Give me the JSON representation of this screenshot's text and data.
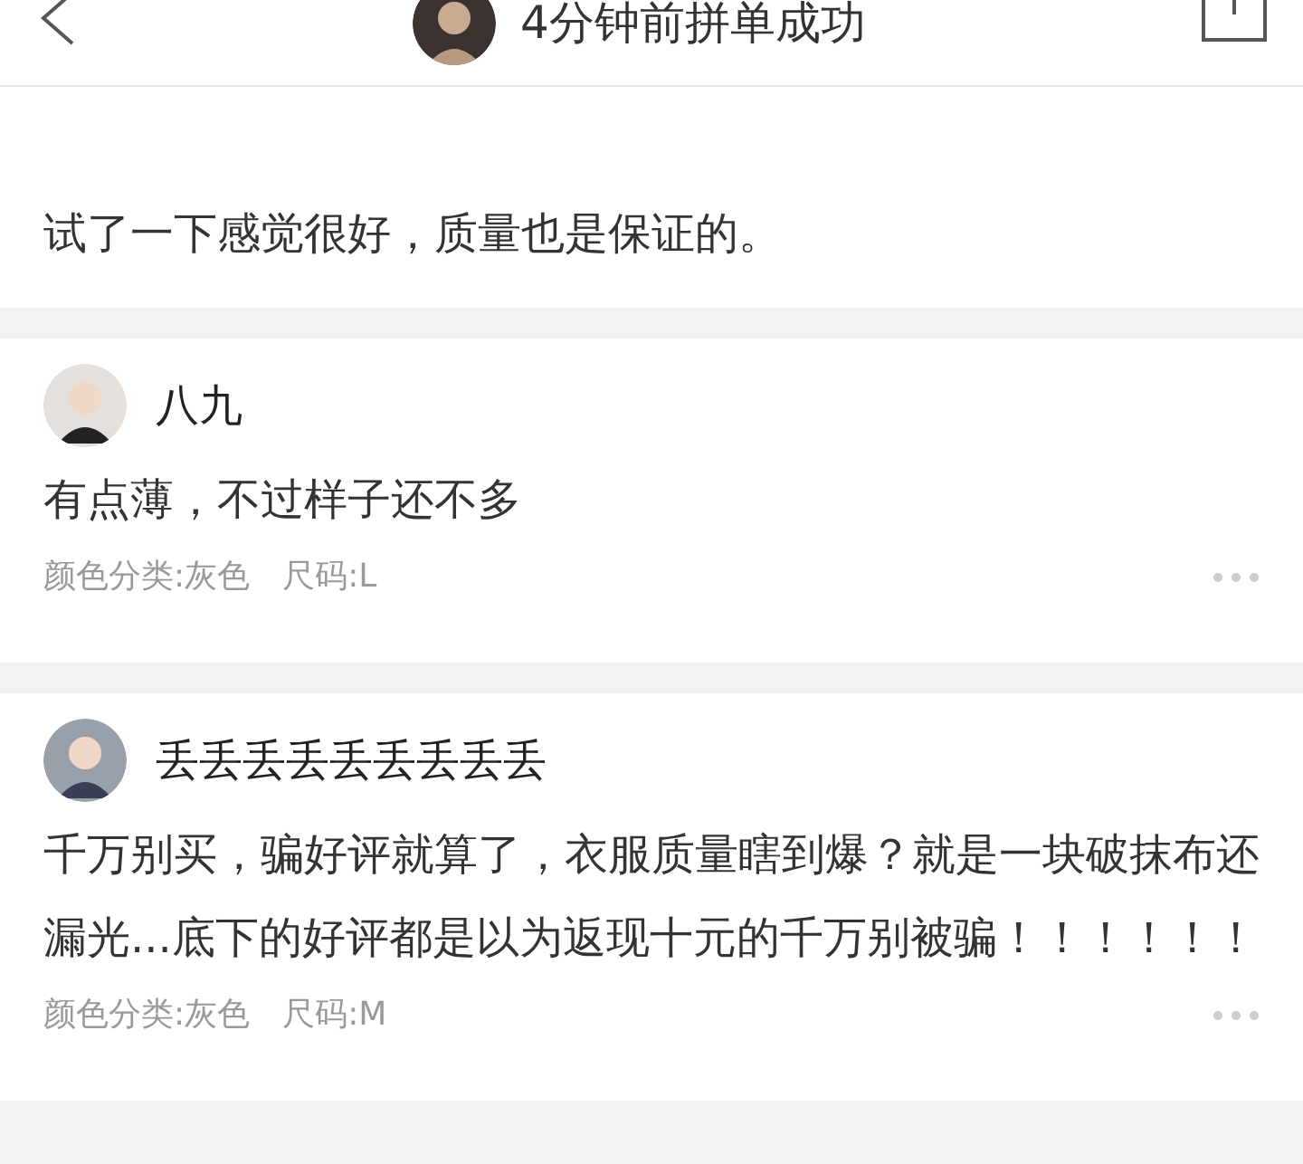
{
  "header": {
    "title": "4分钟前拼单成功"
  },
  "reviews": [
    {
      "text": "试了一下感觉很好，质量也是保证的。"
    },
    {
      "user": "八九",
      "text": "有点薄，不过样子还不多",
      "specs": [
        "颜色分类:灰色",
        "尺码:L"
      ]
    },
    {
      "user": "丢丢丢丢丢丢丢丢丢",
      "text": "千万别买，骗好评就算了，衣服质量瞎到爆？就是一块破抹布还漏光...底下的好评都是以为返现十元的千万别被骗！！！！！！",
      "specs": [
        "颜色分类:灰色",
        "尺码:M"
      ]
    }
  ]
}
